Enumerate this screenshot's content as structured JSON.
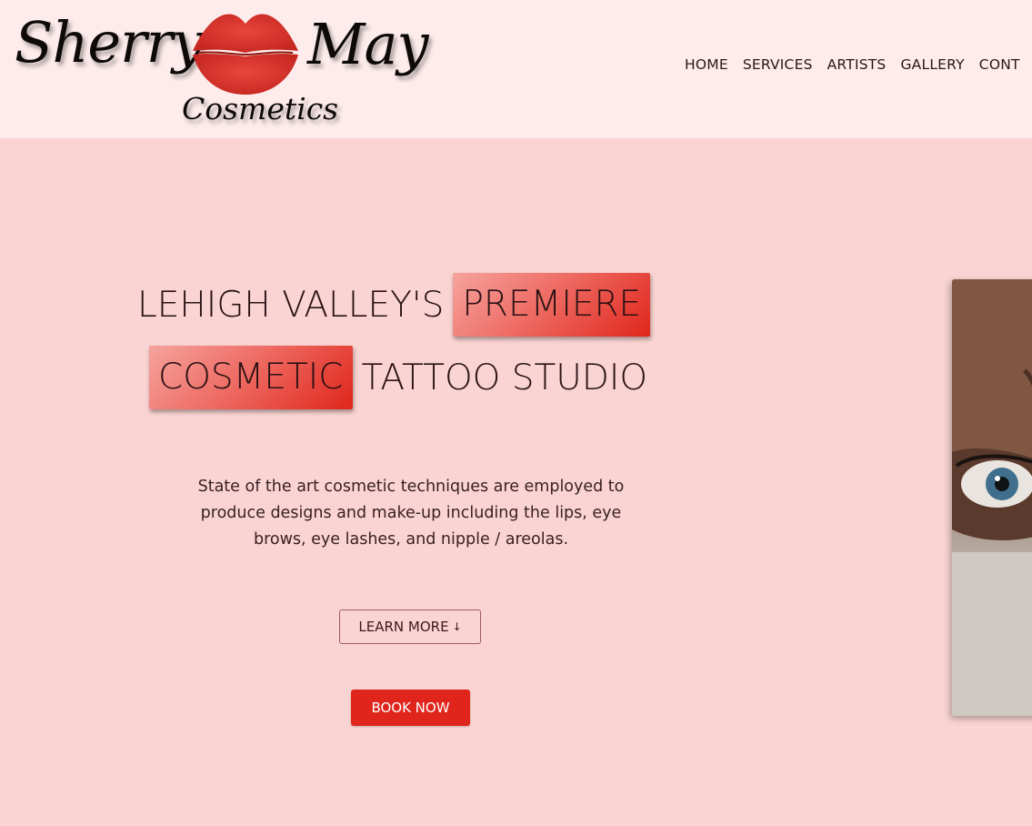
{
  "brand": {
    "logo_word_1": "Sherry",
    "logo_word_2": "May",
    "logo_subtitle": "Cosmetics",
    "lips_color": "#d9302a"
  },
  "nav": {
    "items": [
      {
        "label": "HOME"
      },
      {
        "label": "SERVICES"
      },
      {
        "label": "ARTISTS"
      },
      {
        "label": "GALLERY"
      },
      {
        "label": "CONT"
      }
    ]
  },
  "hero": {
    "line1_plain": "LEHIGH VALLEY'S",
    "line1_highlight": "PREMIERE",
    "line2_highlight": "COSMETIC",
    "line2_plain": "TATTOO STUDIO",
    "description": "State of the art cosmetic techniques are employed to produce designs and make-up including the lips, eye brows, eye lashes, and nipple / areolas.",
    "learn_more_label": "LEARN MORE",
    "learn_more_icon": "arrow-down-icon",
    "book_now_label": "BOOK NOW"
  },
  "colors": {
    "header_bg": "#fdeceb",
    "page_bg": "#f9d4d2",
    "accent_red": "#e0261c",
    "text_dark": "#2b1214"
  }
}
